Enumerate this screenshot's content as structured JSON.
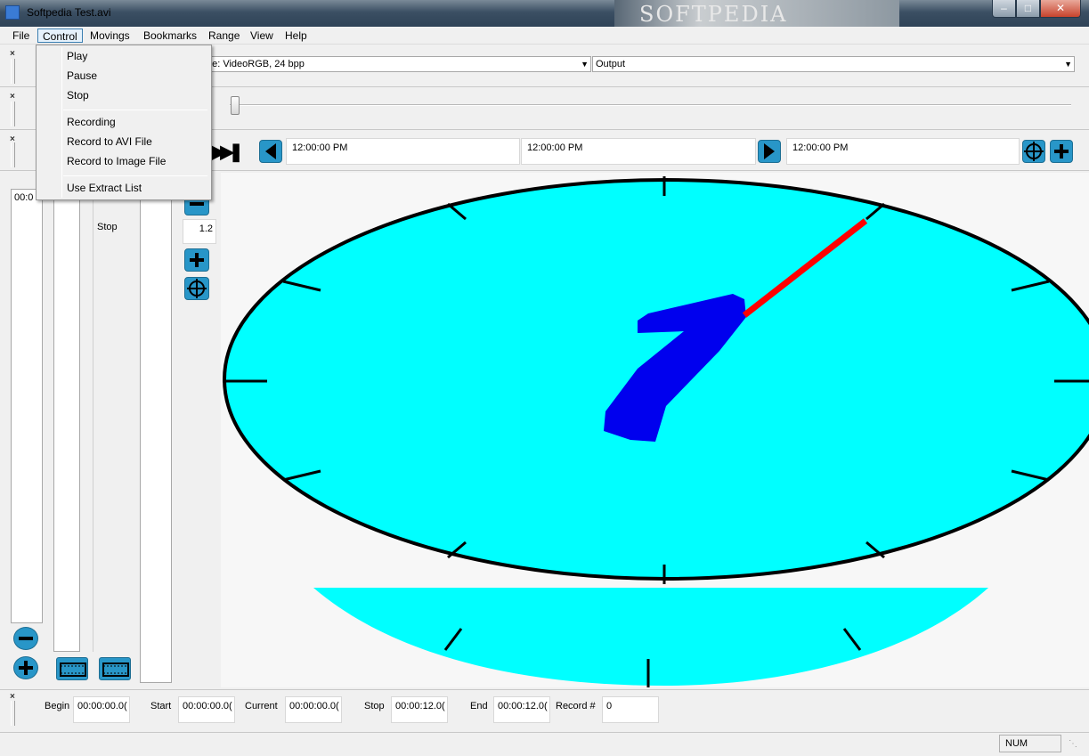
{
  "window": {
    "title": "Softpedia Test.avi",
    "watermark": "SOFTPEDIA"
  },
  "menubar": {
    "items": [
      {
        "label": "File"
      },
      {
        "label": "Control"
      },
      {
        "label": "Movings"
      },
      {
        "label": "Bookmarks"
      },
      {
        "label": "Range"
      },
      {
        "label": "View"
      },
      {
        "label": "Help"
      }
    ]
  },
  "control_menu": {
    "items": [
      {
        "label": "Play"
      },
      {
        "label": "Pause"
      },
      {
        "label": "Stop"
      },
      {
        "label": "Recording"
      },
      {
        "label": "Record to AVI File"
      },
      {
        "label": "Record to Image File"
      },
      {
        "label": "Use Extract List"
      }
    ]
  },
  "toolbar1": {
    "type_combo": "pe: VideoRGB, 24 bpp",
    "output_combo": "Output"
  },
  "toolbar3": {
    "time_fields": [
      "12:00:00 PM",
      "12:00:00 PM",
      "12:00:00 PM"
    ]
  },
  "left_panel": {
    "list_value": "00:0",
    "state_label": "Stop",
    "zoom_value": "1.2"
  },
  "statusbar": {
    "fields": [
      {
        "label": "Begin",
        "value": "00:00:00.0("
      },
      {
        "label": "Start",
        "value": "00:00:00.0("
      },
      {
        "label": "Current",
        "value": "00:00:00.0("
      },
      {
        "label": "Stop",
        "value": "00:00:12.0("
      },
      {
        "label": "End",
        "value": "00:00:12.0("
      },
      {
        "label": "Record #",
        "value": "0"
      }
    ],
    "num_indicator": "NUM"
  },
  "colors": {
    "clock_face": "#00ffff",
    "hour_hand": "#0000ee",
    "second_hand": "#ff0000",
    "button_blue": "#2896c8"
  }
}
